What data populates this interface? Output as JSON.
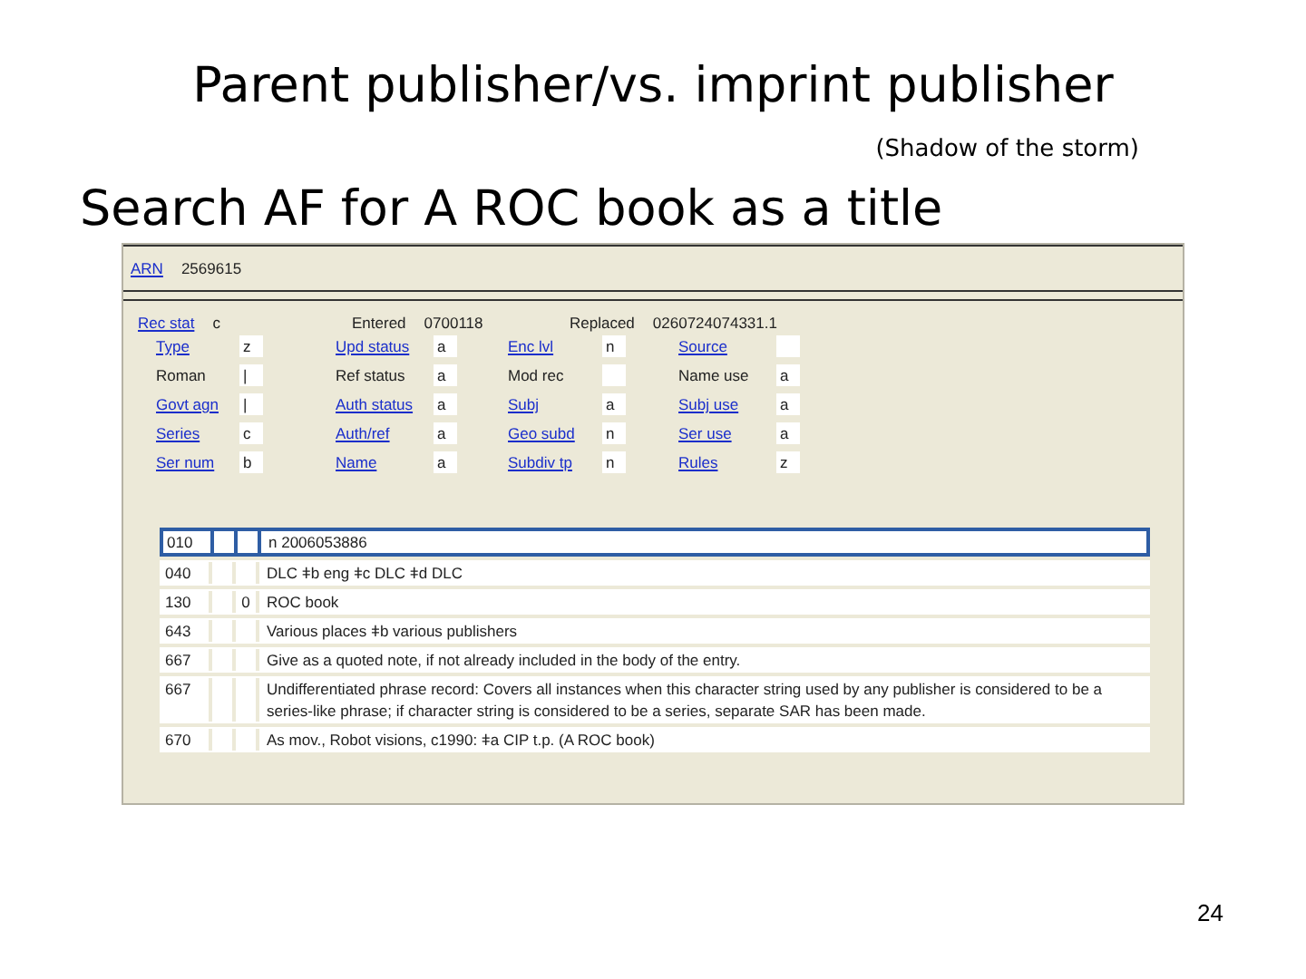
{
  "slide": {
    "title": "Parent publisher/vs. imprint publisher",
    "subtitle": "(Shadow of the storm)",
    "heading": "Search AF for A ROC book as a title",
    "page_number": "24"
  },
  "screen": {
    "arn": {
      "label": "ARN",
      "value": "2569615"
    },
    "header_fields": [
      {
        "label": "Rec stat",
        "value": "c",
        "link": true
      },
      {
        "label": "Entered",
        "value": "0700118",
        "link": false
      },
      {
        "label": "Replaced",
        "value": "0260724074331.1",
        "link": false
      }
    ],
    "fixed_fields": [
      [
        {
          "label": "Type",
          "value": "z",
          "link": true
        },
        {
          "label": "Upd status",
          "value": "a",
          "link": true
        },
        {
          "label": "Enc lvl",
          "value": "n",
          "link": true
        },
        {
          "label": "Source",
          "link": true
        }
      ],
      [
        {
          "label": "Roman",
          "value": "|",
          "link": false
        },
        {
          "label": "Ref status",
          "value": "a",
          "link": false
        },
        {
          "label": "Mod rec",
          "link": false
        },
        {
          "label": "Name use",
          "value": "a",
          "link": false
        }
      ],
      [
        {
          "label": "Govt agn",
          "value": "|",
          "link": true
        },
        {
          "label": "Auth status",
          "value": "a",
          "link": true
        },
        {
          "label": "Subj",
          "value": "a",
          "link": true
        },
        {
          "label": "Subj use",
          "value": "a",
          "link": true
        }
      ],
      [
        {
          "label": "Series",
          "value": "c",
          "link": true
        },
        {
          "label": "Auth/ref",
          "value": "a",
          "link": true
        },
        {
          "label": "Geo subd",
          "value": "n",
          "link": true
        },
        {
          "label": "Ser use",
          "value": "a",
          "link": true
        }
      ],
      [
        {
          "label": "Ser num",
          "value": "b",
          "link": true
        },
        {
          "label": "Name",
          "value": "a",
          "link": true
        },
        {
          "label": "Subdiv tp",
          "value": "n",
          "link": true
        },
        {
          "label": "Rules",
          "value": "z",
          "link": true
        }
      ]
    ],
    "variable_fields": [
      {
        "tag": "010",
        "text": "n 2006053886",
        "selected": true
      },
      {
        "tag": "040",
        "text": "DLC ǂb eng ǂc DLC ǂd DLC",
        "selected": false
      },
      {
        "tag": "130",
        "ind2": "0",
        "text": "ROC book",
        "selected": false
      },
      {
        "tag": "643",
        "text": "Various places ǂb various publishers",
        "selected": false
      },
      {
        "tag": "667",
        "text": "Give as a quoted note, if not already included in the body of the entry.",
        "selected": false
      },
      {
        "tag": "667",
        "text": "Undifferentiated phrase record: Covers all instances when this character string used by any publisher is considered to be a series-like phrase; if character string is considered to be a series, separate SAR has been made.",
        "selected": false
      },
      {
        "tag": "670",
        "text": "As mov., Robot visions, c1990: ǂa CIP t.p. (A ROC book)",
        "selected": false
      }
    ]
  }
}
